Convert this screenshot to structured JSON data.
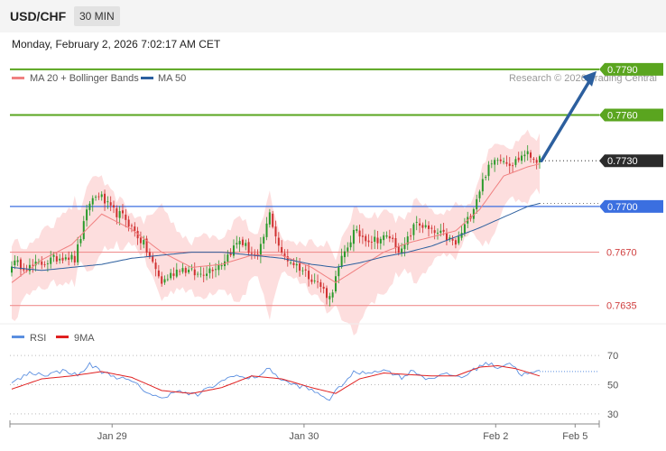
{
  "header": {
    "symbol": "USD/CHF",
    "timeframe": "30 MIN"
  },
  "timestamp": "Monday, February 2, 2026 7:02:17 AM CET",
  "legend": {
    "ma20": {
      "label": "MA 20 + Bollinger Bands",
      "color": "#f08080"
    },
    "ma50": {
      "label": "MA 50",
      "color": "#2c5f9e"
    },
    "credit": "Research © 2026 Trading Central"
  },
  "colors": {
    "green_level": "#5aa51f",
    "blue_level": "#3b6fe0",
    "red_level": "#f09090",
    "current_price": "#2b2b2b",
    "bull_candle": "#2a9a2a",
    "bear_candle": "#d03030",
    "bollinger_fill": "#fdd8d8",
    "arrow": "#2c5f9e",
    "rsi": "#5b8fe0",
    "rsi_ma": "#e02020"
  },
  "chart_data": [
    {
      "type": "candlestick",
      "ylim": [
        0.762,
        0.78
      ],
      "x_tick_labels": [
        "Jan 29",
        "Jan 30",
        "Feb 2",
        "Feb 5"
      ],
      "x_tick_positions": [
        0.1734,
        0.4991,
        0.8243,
        0.9591
      ],
      "levels": [
        {
          "value": 0.779,
          "label": "0.7790",
          "kind": "resistance",
          "color": "green"
        },
        {
          "value": 0.776,
          "label": "0.7760",
          "kind": "resistance",
          "color": "green"
        },
        {
          "value": 0.773,
          "label": "0.7730",
          "kind": "current",
          "color": "dark"
        },
        {
          "value": 0.77,
          "label": "0.7700",
          "kind": "pivot",
          "color": "blue"
        },
        {
          "value": 0.767,
          "label": "0.7670",
          "kind": "support",
          "color": "red"
        },
        {
          "value": 0.7635,
          "label": "0.7635",
          "kind": "support",
          "color": "red"
        }
      ],
      "close_anchors": [
        [
          0,
          0.7663
        ],
        [
          6,
          0.766
        ],
        [
          12,
          0.7664
        ],
        [
          18,
          0.7668
        ],
        [
          21,
          0.7665
        ],
        [
          26,
          0.7703
        ],
        [
          29,
          0.7708
        ],
        [
          33,
          0.7698
        ],
        [
          38,
          0.7692
        ],
        [
          44,
          0.7675
        ],
        [
          50,
          0.765
        ],
        [
          56,
          0.766
        ],
        [
          62,
          0.7655
        ],
        [
          70,
          0.7663
        ],
        [
          76,
          0.7678
        ],
        [
          82,
          0.7665
        ],
        [
          86,
          0.7695
        ],
        [
          90,
          0.7668
        ],
        [
          96,
          0.766
        ],
        [
          102,
          0.765
        ],
        [
          106,
          0.764
        ],
        [
          110,
          0.7665
        ],
        [
          114,
          0.7683
        ],
        [
          120,
          0.7678
        ],
        [
          126,
          0.768
        ],
        [
          130,
          0.767
        ],
        [
          135,
          0.769
        ],
        [
          140,
          0.7683
        ],
        [
          144,
          0.7681
        ],
        [
          148,
          0.7675
        ],
        [
          153,
          0.7695
        ],
        [
          158,
          0.7722
        ],
        [
          162,
          0.7733
        ],
        [
          167,
          0.7728
        ],
        [
          171,
          0.7735
        ],
        [
          176,
          0.773
        ]
      ],
      "ma20_anchors": [
        [
          0,
          0.765
        ],
        [
          10,
          0.7665
        ],
        [
          20,
          0.7675
        ],
        [
          30,
          0.7695
        ],
        [
          40,
          0.7685
        ],
        [
          50,
          0.767
        ],
        [
          60,
          0.766
        ],
        [
          70,
          0.7662
        ],
        [
          80,
          0.7668
        ],
        [
          90,
          0.7668
        ],
        [
          100,
          0.766
        ],
        [
          108,
          0.765
        ],
        [
          116,
          0.766
        ],
        [
          124,
          0.767
        ],
        [
          132,
          0.7676
        ],
        [
          140,
          0.768
        ],
        [
          148,
          0.7684
        ],
        [
          156,
          0.7698
        ],
        [
          164,
          0.772
        ],
        [
          172,
          0.7726
        ],
        [
          176,
          0.7728
        ]
      ],
      "ma50_anchors": [
        [
          0,
          0.766
        ],
        [
          10,
          0.7658
        ],
        [
          20,
          0.766
        ],
        [
          30,
          0.7662
        ],
        [
          40,
          0.7666
        ],
        [
          50,
          0.7668
        ],
        [
          60,
          0.767
        ],
        [
          70,
          0.767
        ],
        [
          80,
          0.7668
        ],
        [
          90,
          0.7666
        ],
        [
          100,
          0.7662
        ],
        [
          108,
          0.766
        ],
        [
          116,
          0.7663
        ],
        [
          124,
          0.7667
        ],
        [
          132,
          0.767
        ],
        [
          140,
          0.7674
        ],
        [
          148,
          0.768
        ],
        [
          156,
          0.7686
        ],
        [
          164,
          0.7693
        ],
        [
          172,
          0.77
        ],
        [
          176,
          0.7702
        ]
      ],
      "projection": {
        "from": 0.773,
        "to": 0.779
      }
    },
    {
      "type": "line",
      "series": [
        {
          "name": "RSI"
        },
        {
          "name": "9MA"
        }
      ],
      "ylim": [
        25,
        75
      ],
      "y_ticks": [
        70,
        50,
        30
      ],
      "rsi_anchors": [
        [
          0,
          51
        ],
        [
          6,
          58
        ],
        [
          12,
          57
        ],
        [
          18,
          60
        ],
        [
          22,
          56
        ],
        [
          26,
          64
        ],
        [
          30,
          59
        ],
        [
          34,
          56
        ],
        [
          40,
          52
        ],
        [
          46,
          44
        ],
        [
          50,
          40
        ],
        [
          54,
          46
        ],
        [
          58,
          44
        ],
        [
          62,
          43
        ],
        [
          66,
          48
        ],
        [
          70,
          52
        ],
        [
          74,
          57
        ],
        [
          78,
          54
        ],
        [
          82,
          56
        ],
        [
          86,
          61
        ],
        [
          90,
          53
        ],
        [
          94,
          50
        ],
        [
          98,
          48
        ],
        [
          102,
          44
        ],
        [
          106,
          40
        ],
        [
          110,
          50
        ],
        [
          114,
          58
        ],
        [
          118,
          58
        ],
        [
          122,
          60
        ],
        [
          126,
          59
        ],
        [
          130,
          55
        ],
        [
          134,
          60
        ],
        [
          138,
          54
        ],
        [
          142,
          56
        ],
        [
          146,
          57
        ],
        [
          150,
          55
        ],
        [
          154,
          60
        ],
        [
          158,
          65
        ],
        [
          162,
          62
        ],
        [
          166,
          65
        ],
        [
          170,
          57
        ],
        [
          174,
          58
        ],
        [
          176,
          59
        ]
      ],
      "rsi_ma_anchors": [
        [
          0,
          47
        ],
        [
          10,
          54
        ],
        [
          20,
          56
        ],
        [
          30,
          59
        ],
        [
          40,
          55
        ],
        [
          50,
          46
        ],
        [
          60,
          44
        ],
        [
          70,
          48
        ],
        [
          80,
          56
        ],
        [
          90,
          54
        ],
        [
          100,
          48
        ],
        [
          108,
          44
        ],
        [
          116,
          54
        ],
        [
          124,
          58
        ],
        [
          132,
          57
        ],
        [
          140,
          56
        ],
        [
          148,
          56
        ],
        [
          156,
          62
        ],
        [
          162,
          63
        ],
        [
          168,
          61
        ],
        [
          176,
          56
        ]
      ],
      "rsi_last": 59
    }
  ]
}
